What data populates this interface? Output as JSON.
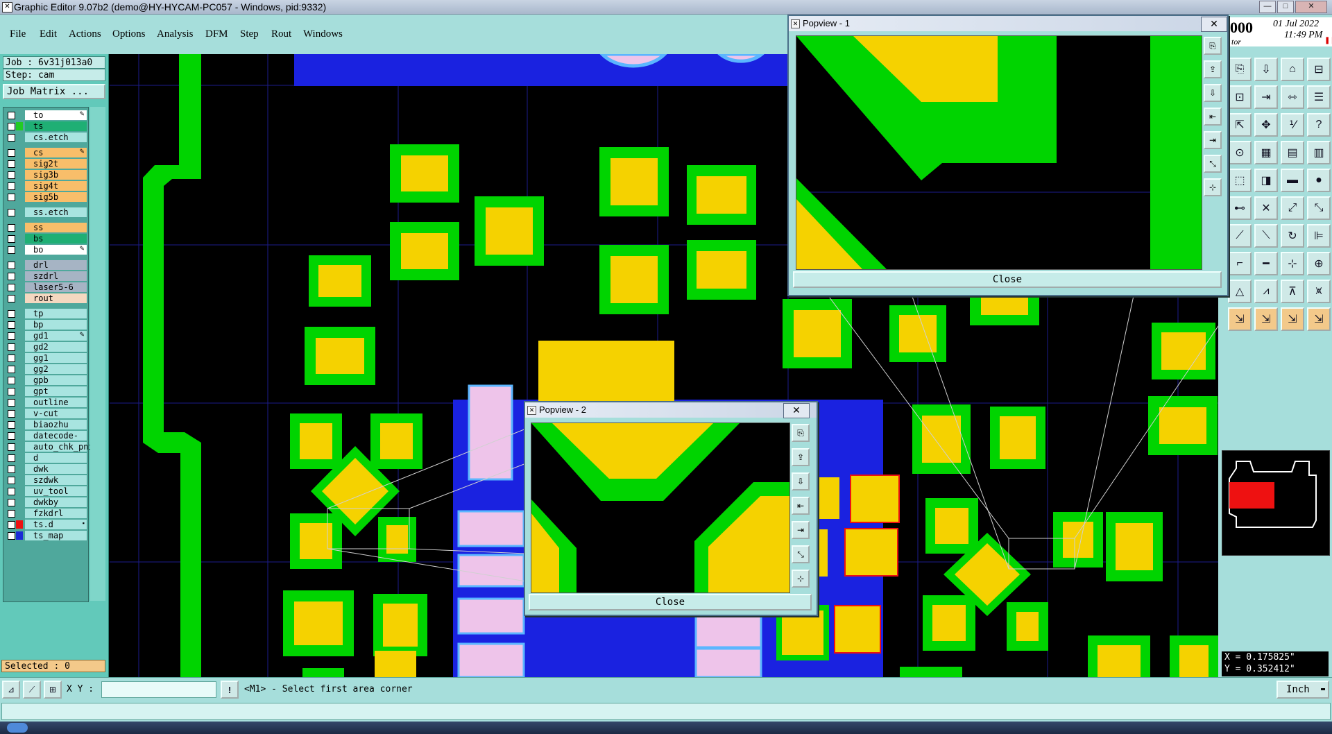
{
  "window": {
    "title": "Graphic Editor 9.07b2 (demo@HY-HYCAM-PC057 - Windows, pid:9332)",
    "min_label": "—",
    "max_label": "□",
    "close_label": "✕"
  },
  "menu": [
    "File",
    "Edit",
    "Actions",
    "Options",
    "Analysis",
    "DFM",
    "Step",
    "Rout",
    "Windows"
  ],
  "job": {
    "job_label": "Job : 6v31j013a0",
    "step_label": "Step: cam",
    "matrix_button": "Job Matrix ..."
  },
  "layers": [
    {
      "name": "to",
      "bg": "#ffffff",
      "swatch": "",
      "mark": "✎"
    },
    {
      "name": "ts",
      "bg": "#1faf74",
      "swatch": "#22cc22",
      "mark": ""
    },
    {
      "name": "cs.etch",
      "bg": "#a8e4e0",
      "swatch": "",
      "mark": ""
    },
    {
      "name": "cs",
      "bg": "#f8be6a",
      "swatch": "",
      "mark": "✎"
    },
    {
      "name": "sig2t",
      "bg": "#f8be6a",
      "swatch": "",
      "mark": ""
    },
    {
      "name": "sig3b",
      "bg": "#f8be6a",
      "swatch": "",
      "mark": ""
    },
    {
      "name": "sig4t",
      "bg": "#f8be6a",
      "swatch": "",
      "mark": ""
    },
    {
      "name": "sig5b",
      "bg": "#f8be6a",
      "swatch": "",
      "mark": ""
    },
    {
      "name": "ss.etch",
      "bg": "#a8e4e0",
      "swatch": "",
      "mark": ""
    },
    {
      "name": "ss",
      "bg": "#f8be6a",
      "swatch": "",
      "mark": ""
    },
    {
      "name": "bs",
      "bg": "#1faf74",
      "swatch": "",
      "mark": ""
    },
    {
      "name": "bo",
      "bg": "#ffffff",
      "swatch": "",
      "mark": "✎"
    },
    {
      "name": "drl",
      "bg": "#a6b4c4",
      "swatch": "",
      "mark": ""
    },
    {
      "name": "szdrl",
      "bg": "#a6b4c4",
      "swatch": "",
      "mark": ""
    },
    {
      "name": "laser5-6",
      "bg": "#a6b4c4",
      "swatch": "",
      "mark": ""
    },
    {
      "name": "rout",
      "bg": "#f4d8c0",
      "swatch": "",
      "mark": ""
    },
    {
      "name": "tp",
      "bg": "#a8e4e0",
      "swatch": "",
      "mark": ""
    },
    {
      "name": "bp",
      "bg": "#a8e4e0",
      "swatch": "",
      "mark": ""
    },
    {
      "name": "gd1",
      "bg": "#a8e4e0",
      "swatch": "",
      "mark": "✎"
    },
    {
      "name": "gd2",
      "bg": "#a8e4e0",
      "swatch": "",
      "mark": ""
    },
    {
      "name": "gg1",
      "bg": "#a8e4e0",
      "swatch": "",
      "mark": ""
    },
    {
      "name": "gg2",
      "bg": "#a8e4e0",
      "swatch": "",
      "mark": ""
    },
    {
      "name": "gpb",
      "bg": "#a8e4e0",
      "swatch": "",
      "mark": ""
    },
    {
      "name": "gpt",
      "bg": "#a8e4e0",
      "swatch": "",
      "mark": ""
    },
    {
      "name": "outline",
      "bg": "#a8e4e0",
      "swatch": "",
      "mark": ""
    },
    {
      "name": "v-cut",
      "bg": "#a8e4e0",
      "swatch": "",
      "mark": ""
    },
    {
      "name": "biaozhu",
      "bg": "#a8e4e0",
      "swatch": "",
      "mark": ""
    },
    {
      "name": "datecode-pte",
      "bg": "#a8e4e0",
      "swatch": "",
      "mark": ""
    },
    {
      "name": "auto_chk_pni",
      "bg": "#a8e4e0",
      "swatch": "",
      "mark": ""
    },
    {
      "name": "d",
      "bg": "#a8e4e0",
      "swatch": "",
      "mark": ""
    },
    {
      "name": "dwk",
      "bg": "#a8e4e0",
      "swatch": "",
      "mark": ""
    },
    {
      "name": "szdwk",
      "bg": "#a8e4e0",
      "swatch": "",
      "mark": ""
    },
    {
      "name": "uv_tool",
      "bg": "#a8e4e0",
      "swatch": "",
      "mark": ""
    },
    {
      "name": "dwkby",
      "bg": "#a8e4e0",
      "swatch": "",
      "mark": ""
    },
    {
      "name": "fzkdrl",
      "bg": "#a8e4e0",
      "swatch": "",
      "mark": ""
    },
    {
      "name": "ts.d",
      "bg": "#a8e4e0",
      "swatch": "#ee1111",
      "mark": "▪"
    },
    {
      "name": "ts_map",
      "bg": "#a8e4e0",
      "swatch": "#1a2bd6",
      "mark": ""
    }
  ],
  "selected_label": "Selected : 0",
  "clock": {
    "num": "000",
    "date": "01 Jul 2022",
    "time": "11:49 PM",
    "sub": "tor"
  },
  "coords": {
    "x": "X = 0.175825\"",
    "y": "Y = 0.352412\""
  },
  "status": {
    "xy_label": "X Y :",
    "xy_value": "",
    "prompt": "<M1> - Select first area corner",
    "units": "Inch"
  },
  "popview1": {
    "title": "Popview - 1",
    "close": "Close"
  },
  "popview2": {
    "title": "Popview - 2",
    "close": "Close"
  },
  "colors": {
    "pad": "#f5d200",
    "mask": "#00d400",
    "plane": "#1a22e0",
    "pink": "#eec4ea",
    "grid": "#1a1a9a",
    "red": "#ee1111"
  }
}
